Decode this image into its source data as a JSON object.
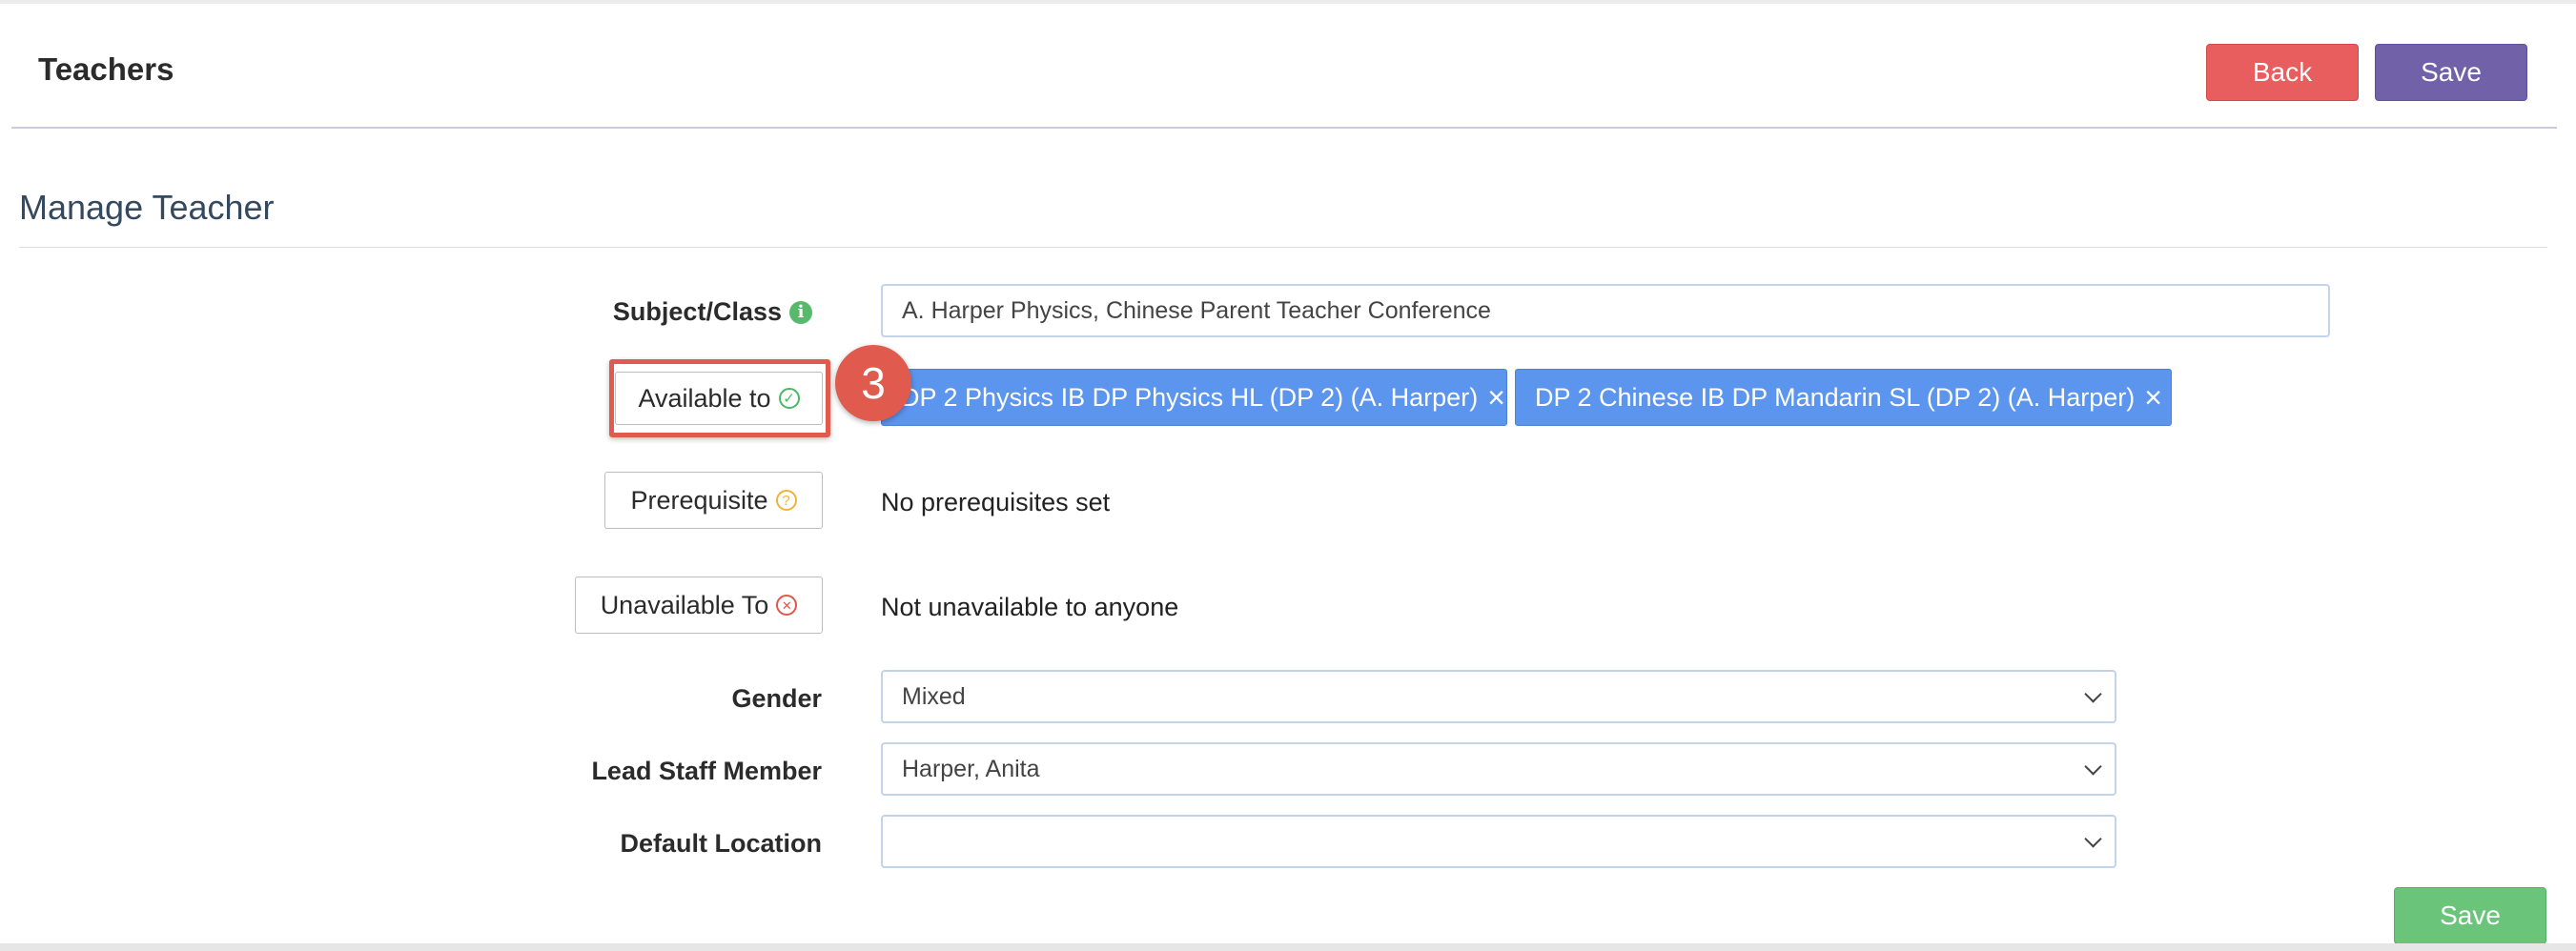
{
  "header": {
    "title": "Teachers",
    "back_label": "Back",
    "save_label": "Save"
  },
  "section": {
    "title": "Manage Teacher"
  },
  "form": {
    "subject_label": "Subject/Class",
    "subject_value": "A. Harper Physics, Chinese Parent Teacher Conference",
    "available_label": "Available to",
    "available_tags": [
      "DP 2 Physics IB DP Physics HL (DP 2) (A. Harper)",
      "DP 2 Chinese IB DP Mandarin SL (DP 2) (A. Harper)"
    ],
    "prerequisite_label": "Prerequisite",
    "prerequisite_text": "No prerequisites set",
    "unavailable_label": "Unavailable To",
    "unavailable_text": "Not unavailable to anyone",
    "gender_label": "Gender",
    "gender_value": "Mixed",
    "lead_staff_label": "Lead Staff Member",
    "lead_staff_value": "Harper, Anita",
    "location_label": "Default Location",
    "location_value": ""
  },
  "footer": {
    "save_label": "Save"
  },
  "annotation": {
    "step_number": "3"
  },
  "icons": {
    "subject_info": "info-icon",
    "available": "check-circle-icon",
    "prerequisite": "question-circle-icon",
    "unavailable": "x-circle-icon",
    "tag_remove": "close-icon",
    "select_arrow": "chevron-down-icon"
  },
  "colors": {
    "back_button": "#e85d5d",
    "save_button": "#7161a8",
    "footer_save_button": "#6ac47a",
    "tag_background": "#5b95ee",
    "highlight": "#e05a4d"
  }
}
